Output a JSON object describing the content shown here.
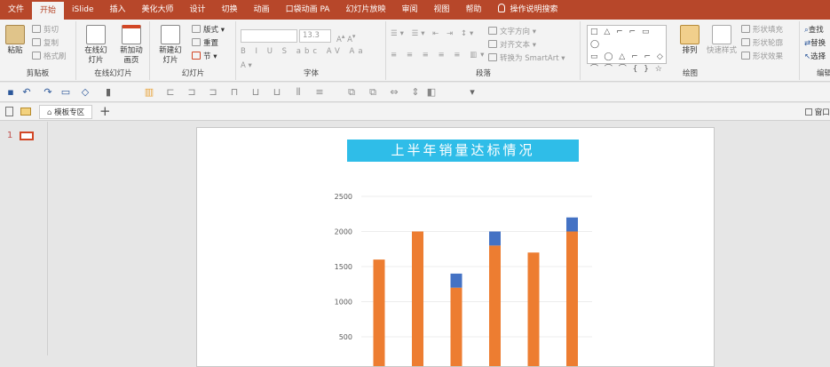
{
  "menu": {
    "file": "文件",
    "tabs": [
      "开始",
      "iSlide",
      "插入",
      "美化大师",
      "设计",
      "切换",
      "动画",
      "口袋动画 PA",
      "幻灯片放映",
      "审阅",
      "视图",
      "帮助"
    ],
    "tell_me": "操作说明搜索"
  },
  "ribbon": {
    "clipboard": {
      "paste": "粘贴",
      "cut": "剪切",
      "copy": "复制",
      "format_painter": "格式刷",
      "label": "剪贴板"
    },
    "online_slides": {
      "online": "在线幻灯片",
      "new_anim": "新加动画页",
      "label": "在线幻灯片"
    },
    "slides": {
      "new_slide": "新建幻灯片",
      "layout": "版式",
      "reset": "重置",
      "section": "节",
      "label": "幻灯片"
    },
    "font": {
      "font_name": "",
      "font_size": "13.3",
      "label": "字体"
    },
    "paragraph": {
      "text_direction": "文字方向",
      "align_text": "对齐文本",
      "convert_smartart": "转换为 SmartArt",
      "label": "段落"
    },
    "drawing": {
      "arrange": "排列",
      "quick_styles": "快速样式",
      "shape_fill": "形状填充",
      "shape_outline": "形状轮廓",
      "shape_effects": "形状效果",
      "label": "绘图"
    },
    "editing": {
      "find": "查找",
      "replace": "替换",
      "select": "选择",
      "label": "编辑"
    }
  },
  "tabsbar": {
    "template_tab": "模板专区",
    "window": "窗口"
  },
  "thumbnail": {
    "number": "1"
  },
  "slide": {
    "title": "上半年销量达标情况"
  },
  "colors": {
    "accent": "#b7472a",
    "orange": "#ed7d31",
    "blue": "#4472c4",
    "banner": "#2fbde8"
  },
  "chart_data": {
    "type": "bar",
    "stacked": true,
    "y_ticks": [
      "2500",
      "2000",
      "1500",
      "1000",
      "500"
    ],
    "ylim": [
      0,
      2500
    ],
    "series": [
      {
        "color": "#ed7d31",
        "values": [
          1600,
          2000,
          1200,
          1800,
          1700,
          2000
        ]
      },
      {
        "color": "#4472c4",
        "values": [
          0,
          0,
          200,
          200,
          0,
          200
        ]
      }
    ]
  }
}
